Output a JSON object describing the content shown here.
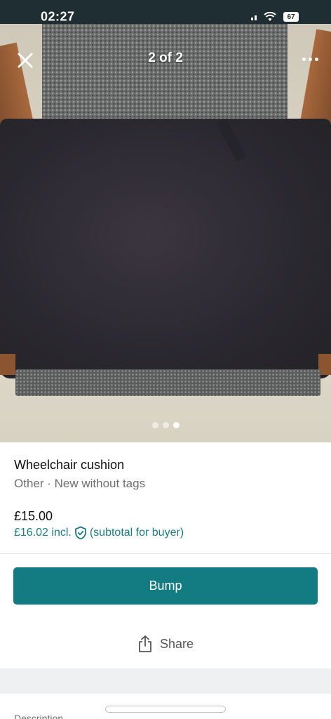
{
  "status_bar": {
    "time": "02:27",
    "battery": "67"
  },
  "photo": {
    "counter": "2 of 2",
    "close_icon": "close-x-icon",
    "more_icon": "more-horizontal-icon",
    "total_images": 3,
    "active_image": 3
  },
  "listing": {
    "title": "Wheelchair cushion",
    "subtitle": "Other · New without tags",
    "price": "£15.00",
    "price_incl": "£16.02 incl.",
    "buyer_note": "(subtotal for buyer)"
  },
  "actions": {
    "bump_label": "Bump",
    "share_label": "Share"
  },
  "description_peek": "Description",
  "colors": {
    "accent": "#137b82",
    "price_incl_text": "#1b7c84",
    "status_bar": "#1f2e33"
  }
}
